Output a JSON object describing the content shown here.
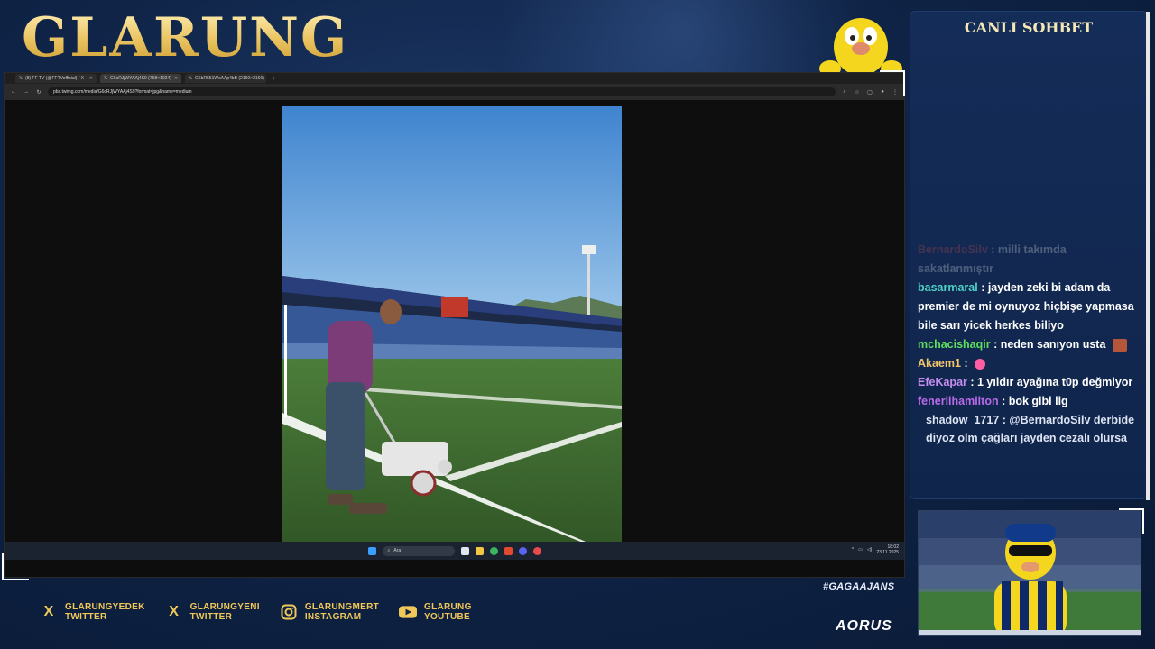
{
  "overlay": {
    "logo": "GLARUNG",
    "hashtag": "#GAGAAJANS",
    "sponsor": "AORUS"
  },
  "socials": [
    {
      "icon": "x-icon",
      "line1": "GLARUNGYEDEK",
      "line2": "TWITTER"
    },
    {
      "icon": "x-icon",
      "line1": "GLARUNGYENI",
      "line2": "TWITTER"
    },
    {
      "icon": "instagram-icon",
      "line1": "GLARUNGMERT",
      "line2": "INSTAGRAM"
    },
    {
      "icon": "youtube-icon",
      "line1": "GLARUNG",
      "line2": "YOUTUBE"
    }
  ],
  "browser": {
    "tabs": [
      {
        "label": "(8) FF TV (@FFTVofficial) / X",
        "active": false
      },
      {
        "label": "G6cRJjWYAAj4S9 (768×1024)",
        "active": true
      },
      {
        "label": "G6bR551WcAAp4bB (2160×2160)",
        "active": false
      }
    ],
    "url": "pbs.twimg.com/media/G6cRJjWYAAj4S9?format=jpg&name=medium"
  },
  "taskbar": {
    "search_placeholder": "Ara",
    "time": "18:02",
    "date": "23.11.2025"
  },
  "chat": {
    "title": "CANLI SOHBET",
    "messages": [
      {
        "user": "BernardoSilv",
        "text": ": milli takımda sakatlanmıştır",
        "color": "#d9534f",
        "faded": true
      },
      {
        "user": "basarmaral",
        "text": ": jayden zeki bi adam da premier de mi oynuyoz hiçbişe yapmasa bile sarı yicek herkes biliyo",
        "color": "#4fd1c5"
      },
      {
        "user": "mchacishaqir",
        "text": ": neden sanıyon usta",
        "color": "#5ee05e"
      },
      {
        "user": "Akaem1",
        "text": ":",
        "color": "#f2c46b"
      },
      {
        "user": "EfeKapar",
        "text": ": 1 yıldır ayağına t0p değmiyor",
        "color": "#c58df0"
      },
      {
        "user": "fenerlihamilton",
        "text": ": bok gibi lig",
        "color": "#b86ae8"
      },
      {
        "user": "shadow_1717",
        "text": ": @BernardoSilv derbide diyoz olm çağları jayden cezalı olursa",
        "color": "#dde4f3"
      }
    ]
  },
  "colors": {
    "background": "#0f2447",
    "gold": "#f0c85a",
    "chat_panel": "#142c58"
  }
}
